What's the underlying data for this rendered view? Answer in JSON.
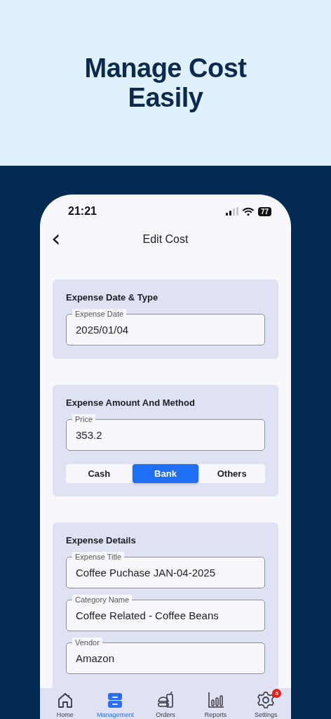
{
  "hero": {
    "title_lines": [
      "Manage Cost",
      "Easily"
    ]
  },
  "status_bar": {
    "time": "21:21",
    "battery": "77"
  },
  "header": {
    "back": "‹",
    "title": "Edit Cost"
  },
  "sections": [
    {
      "title": "Expense Date & Type",
      "fields": [
        {
          "label": "Expense Date",
          "value": "2025/01/04"
        }
      ]
    },
    {
      "title": "Expense Amount And Method",
      "fields": [
        {
          "label": "Price",
          "value": "353.2"
        }
      ],
      "methods": [
        {
          "label": "Cash",
          "selected": false
        },
        {
          "label": "Bank",
          "selected": true
        },
        {
          "label": "Others",
          "selected": false
        }
      ]
    },
    {
      "title": "Expense Details",
      "fields": [
        {
          "label": "Expense Title",
          "value": "Coffee Puchase JAN-04-2025"
        },
        {
          "label": "Category Name",
          "value": "Coffee Related - Coffee Beans"
        },
        {
          "label": "Vendor",
          "value": "Amazon"
        }
      ]
    }
  ],
  "tab_bar": [
    {
      "kind": "home",
      "label": "Home",
      "selected": false
    },
    {
      "kind": "management",
      "label": "Management",
      "selected": true
    },
    {
      "kind": "orders",
      "label": "Orders",
      "selected": false
    },
    {
      "kind": "reports",
      "label": "Reports",
      "selected": false
    },
    {
      "kind": "settings",
      "label": "Settings",
      "selected": false,
      "badge": "5"
    }
  ]
}
